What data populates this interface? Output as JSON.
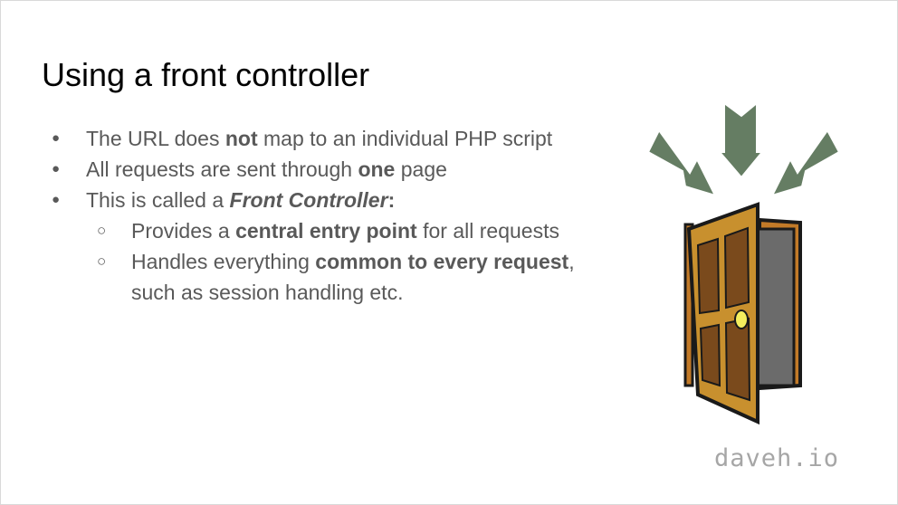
{
  "slide": {
    "title": "Using a front controller",
    "bullets": [
      {
        "parts": [
          {
            "text": "The URL does ",
            "style": "normal"
          },
          {
            "text": "not",
            "style": "bold"
          },
          {
            "text": " map to an individual PHP script",
            "style": "normal"
          }
        ]
      },
      {
        "parts": [
          {
            "text": "All requests are sent through ",
            "style": "normal"
          },
          {
            "text": "one",
            "style": "bold"
          },
          {
            "text": " page",
            "style": "normal"
          }
        ]
      },
      {
        "parts": [
          {
            "text": "This is called a ",
            "style": "normal"
          },
          {
            "text": "Front Controller",
            "style": "bold-italic"
          },
          {
            "text": ":",
            "style": "bold"
          }
        ]
      }
    ],
    "sub_bullets": [
      {
        "parts": [
          {
            "text": "Provides a ",
            "style": "normal"
          },
          {
            "text": "central entry point",
            "style": "bold"
          },
          {
            "text": " for all requests",
            "style": "normal"
          }
        ]
      },
      {
        "parts": [
          {
            "text": "Handles everything ",
            "style": "normal"
          },
          {
            "text": "common to every request",
            "style": "bold"
          },
          {
            "text": ",",
            "style": "normal"
          }
        ]
      },
      {
        "parts": [
          {
            "text": "such as session handling etc.",
            "style": "normal"
          }
        ]
      }
    ],
    "footer": "daveh.io",
    "icons": [
      "arrow-left-icon",
      "arrow-down-icon",
      "arrow-right-icon",
      "open-door-icon"
    ],
    "colors": {
      "arrow": "#657d63",
      "door": "#c8902e",
      "panel": "#7a4a1c",
      "knob": "#f4ee5e",
      "text": "#595959",
      "footer": "#a6a6a6"
    }
  }
}
